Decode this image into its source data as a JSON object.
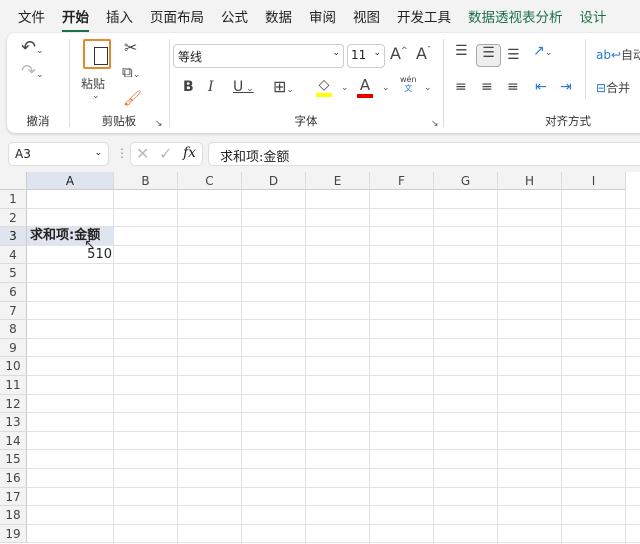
{
  "tabs": [
    "文件",
    "开始",
    "插入",
    "页面布局",
    "公式",
    "数据",
    "审阅",
    "视图",
    "开发工具",
    "数据透视表分析",
    "设计"
  ],
  "active_tab": "开始",
  "accent": "#1e7145",
  "ribbon": {
    "undo_group": "撤消",
    "clipboard": {
      "label": "剪贴板",
      "paste": "粘贴"
    },
    "font": {
      "label": "字体",
      "font_name": "等线",
      "font_size": "11",
      "phonetic_top": "wén",
      "phonetic_bottom": "文",
      "highlight_color": "#ffff00",
      "font_color": "#e00000"
    },
    "align": {
      "label": "对齐方式",
      "wrap": "自动",
      "merge": "合并"
    }
  },
  "formula_bar": {
    "name_box": "A3",
    "fx": "fx",
    "content": "求和项:金额"
  },
  "columns": [
    "A",
    "B",
    "C",
    "D",
    "E",
    "F",
    "G",
    "H",
    "I"
  ],
  "rows": [
    "1",
    "2",
    "3",
    "4",
    "5",
    "6",
    "7",
    "8",
    "9",
    "10",
    "11",
    "12",
    "13",
    "14",
    "15",
    "16",
    "17",
    "18",
    "19"
  ],
  "cells": {
    "A3": "求和项:金额",
    "A4": "510"
  }
}
